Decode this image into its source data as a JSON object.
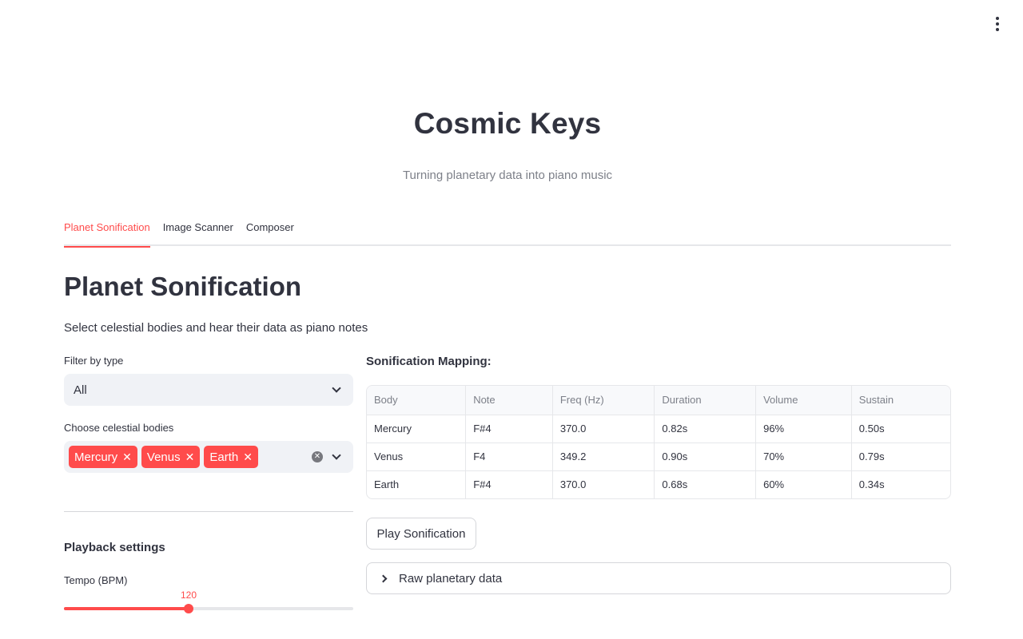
{
  "header": {
    "menu_icon": "vertical-dots-icon"
  },
  "app": {
    "title": "Cosmic Keys",
    "subtitle": "Turning planetary data into piano music"
  },
  "tabs": [
    {
      "label": "Planet Sonification",
      "active": true
    },
    {
      "label": "Image Scanner",
      "active": false
    },
    {
      "label": "Composer",
      "active": false
    }
  ],
  "page": {
    "heading": "Planet Sonification",
    "description": "Select celestial bodies and hear their data as piano notes"
  },
  "filter": {
    "label": "Filter by type",
    "value": "All"
  },
  "bodies": {
    "label": "Choose celestial bodies",
    "selected": [
      "Mercury",
      "Venus",
      "Earth"
    ]
  },
  "playback": {
    "heading": "Playback settings",
    "tempo_label": "Tempo (BPM)",
    "tempo_value": "120",
    "tempo_fraction": 0.43
  },
  "mapping": {
    "heading": "Sonification Mapping:",
    "columns": [
      "Body",
      "Note",
      "Freq (Hz)",
      "Duration",
      "Volume",
      "Sustain"
    ],
    "rows": [
      [
        "Mercury",
        "F#4",
        "370.0",
        "0.82s",
        "96%",
        "0.50s"
      ],
      [
        "Venus",
        "F4",
        "349.2",
        "0.90s",
        "70%",
        "0.79s"
      ],
      [
        "Earth",
        "F#4",
        "370.0",
        "0.68s",
        "60%",
        "0.34s"
      ]
    ]
  },
  "actions": {
    "play_label": "Play Sonification",
    "raw_label": "Raw planetary data"
  },
  "colors": {
    "accent": "#ff4b4b",
    "text": "#31333f",
    "muted": "#7d8089",
    "input_bg": "#f0f2f6"
  }
}
